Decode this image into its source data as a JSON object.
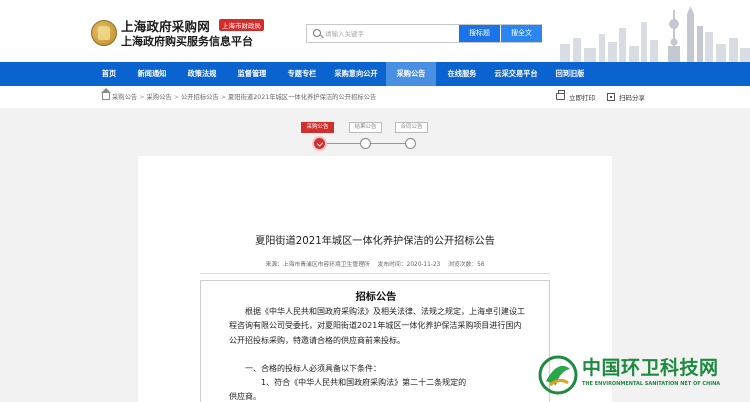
{
  "header": {
    "site_title": "上海政府采购网",
    "site_badge": "上海市财政局",
    "site_subtitle": "上海政府购买服务信息平台",
    "search_placeholder": "请输入关键字",
    "search_bid_label": "搜标题",
    "search_all_label": "搜全文"
  },
  "nav": {
    "items": [
      {
        "label": "首页"
      },
      {
        "label": "新闻通知"
      },
      {
        "label": "政策法规"
      },
      {
        "label": "监督管理"
      },
      {
        "label": "专题专栏"
      },
      {
        "label": "采购意向公开"
      },
      {
        "label": "采购公告",
        "active": true
      },
      {
        "label": "在线服务"
      },
      {
        "label": "云采交易平台"
      },
      {
        "label": "回到旧版"
      }
    ]
  },
  "breadcrumb": {
    "items": [
      "采购公告",
      "采购公告",
      "公开招标公告",
      "夏阳街道2021年城区一体化养护保洁的公开招标公告"
    ],
    "print_label": "立即打印",
    "share_label": "扫码分享"
  },
  "steps": {
    "items": [
      "采购公告",
      "结果公告",
      "合同公告"
    ],
    "active_index": 0
  },
  "article": {
    "title": "夏阳街道2021年城区一体化养护保洁的公开招标公告",
    "meta_source": "来源：上海市青浦区市容环境卫生管理所",
    "meta_date": "发布时间：2020-11-23",
    "meta_views": "浏览次数：56",
    "doc_heading": "招标公告",
    "doc_paragraph": "根据《中华人民共和国政府采购法》及相关法律、法规之规定，上海卓引建设工程咨询有限公司受委托，对夏阳街道2021年城区一体化养护保洁采购项目进行国内公开招投标采购，特邀请合格的供应商前来投标。",
    "doc_line1": "一、合格的投标人必须具备以下条件：",
    "doc_line2": "1、符合《中华人民共和国政府采购法》第二十二条规定的",
    "doc_line3": "供应商。"
  },
  "watermark": {
    "title": "中国环卫科技网",
    "subtitle": "THE ENVIRONMENTAL SANITATION NET OF CHINA"
  },
  "colors": {
    "nav_bg": "#0b63cf",
    "nav_active": "#4a90e2",
    "step_active": "#d32f2f",
    "watermark": "#1d8a3f"
  }
}
